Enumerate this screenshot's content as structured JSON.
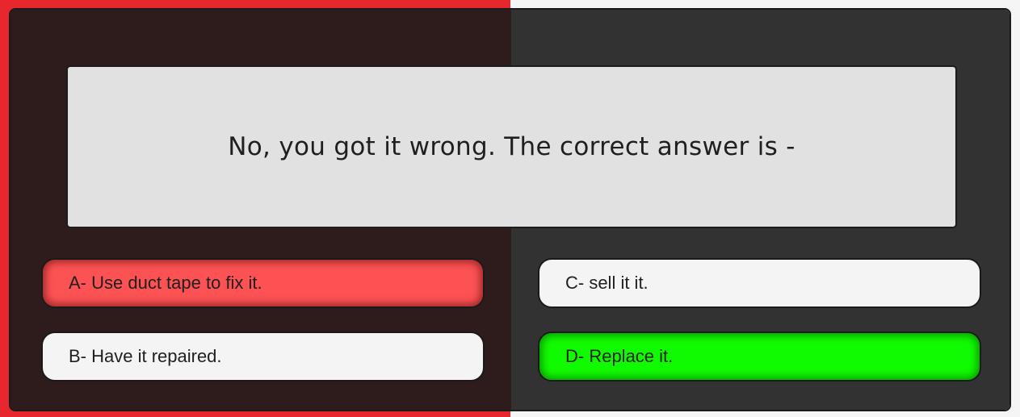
{
  "colors": {
    "background_left": "#e8262e",
    "background_right": "#f5f5f5",
    "panel_left": "#2e1c1c",
    "panel_right": "#323232",
    "question_box": "#e1e1e1",
    "answer_default": "#f4f4f4",
    "answer_wrong": "#fd5254",
    "answer_correct": "#11fb00"
  },
  "question": {
    "text": "No, you got it wrong. The correct answer is -"
  },
  "answers": [
    {
      "label": "A- Use duct tape to fix it.",
      "state": "wrong"
    },
    {
      "label": "B- Have it repaired.",
      "state": "default"
    },
    {
      "label": "C- sell it it.",
      "state": "default"
    },
    {
      "label": "D- Replace it.",
      "state": "correct"
    }
  ]
}
